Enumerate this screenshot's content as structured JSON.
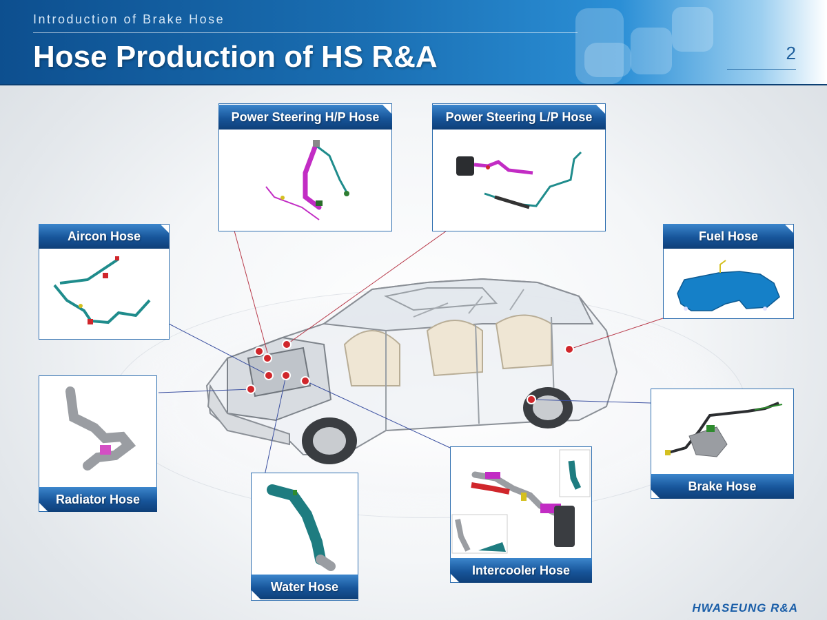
{
  "header": {
    "subtitle": "Introduction of Brake Hose",
    "title": "Hose Production of HS R&A",
    "page_number": "2"
  },
  "panels": {
    "ps_hp": "Power Steering H/P Hose",
    "ps_lp": "Power Steering L/P Hose",
    "aircon": "Aircon Hose",
    "fuel": "Fuel Hose",
    "radiator": "Radiator Hose",
    "brake": "Brake Hose",
    "water": "Water Hose",
    "intercooler": "Intercooler Hose"
  },
  "footer": {
    "logo": "HWASEUNG R&A"
  },
  "colors": {
    "header_blue": "#1a6fb3",
    "label_blue": "#17559a",
    "marker_red": "#d0262b",
    "hose_magenta": "#c22cc4",
    "hose_teal": "#1f8c8c",
    "fuel_tank_blue": "#1580c8"
  }
}
